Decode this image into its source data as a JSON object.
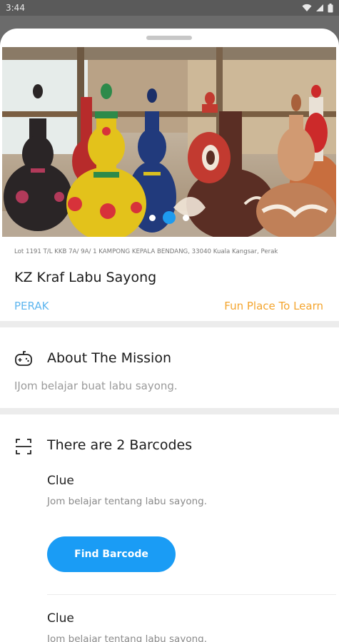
{
  "status_bar": {
    "time": "3:44",
    "icons": [
      "wifi-icon",
      "signal-icon",
      "battery-icon"
    ]
  },
  "carousel": {
    "image": "clay gourd (labu sayong) pottery",
    "slide_count": 3,
    "active_slide": 2
  },
  "place": {
    "address": "Lot 1191 T/L KKB 7A/ 9A/ 1 KAMPONG KEPALA BENDANG, 33040 Kuala Kangsar, Perak",
    "name": "KZ Kraf Labu Sayong",
    "state": "PERAK",
    "category": "Fun Place To Learn"
  },
  "mission": {
    "icon": "gamepad-icon",
    "title": "About The Mission",
    "description": "IJom belajar buat labu sayong."
  },
  "barcodes": {
    "icon": "barcode-scan-icon",
    "title": "There are 2 Barcodes",
    "items": [
      {
        "clue_title": "Clue",
        "clue_text": "Jom belajar tentang labu sayong.",
        "button_label": "Find Barcode"
      },
      {
        "clue_title": "Clue",
        "clue_text": "Jom belajar tentang labu sayong."
      }
    ]
  },
  "colors": {
    "accent_blue": "#1a9cf5",
    "state_blue": "#5fb6ef",
    "category_orange": "#f4a52e",
    "divider_gray": "#ececec"
  }
}
